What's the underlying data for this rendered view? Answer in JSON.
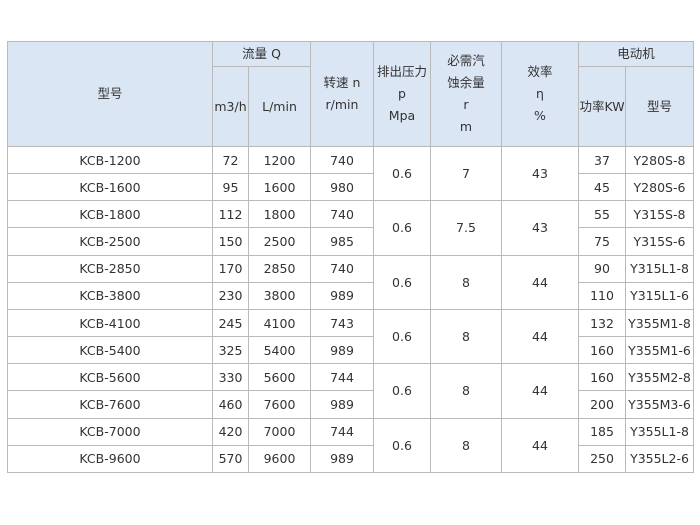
{
  "header": {
    "model": "型号",
    "flow": "流量 Q",
    "flow_m3h": "m3/h",
    "flow_lmin": "L/min",
    "speed_l1": "转速 n",
    "speed_l2": "r/min",
    "pressure_l1": "排出压力",
    "pressure_l2": "p",
    "pressure_l3": "Mpa",
    "npsh_l1": "必需汽",
    "npsh_l2": "蚀余量",
    "npsh_l3": "r",
    "npsh_l4": "m",
    "eff_l1": "效率",
    "eff_l2": "η",
    "eff_l3": "%",
    "motor": "电动机",
    "motor_power": "功率KW",
    "motor_model": "型号"
  },
  "groups": [
    {
      "pressure": "0.6",
      "npsh": "7",
      "efficiency": "43",
      "rows": [
        {
          "model": "KCB-1200",
          "m3h": "72",
          "lmin": "1200",
          "speed": "740",
          "power": "37",
          "motor": "Y280S-8"
        },
        {
          "model": "KCB-1600",
          "m3h": "95",
          "lmin": "1600",
          "speed": "980",
          "power": "45",
          "motor": "Y280S-6"
        }
      ]
    },
    {
      "pressure": "0.6",
      "npsh": "7.5",
      "efficiency": "43",
      "rows": [
        {
          "model": "KCB-1800",
          "m3h": "112",
          "lmin": "1800",
          "speed": "740",
          "power": "55",
          "motor": "Y315S-8"
        },
        {
          "model": "KCB-2500",
          "m3h": "150",
          "lmin": "2500",
          "speed": "985",
          "power": "75",
          "motor": "Y315S-6"
        }
      ]
    },
    {
      "pressure": "0.6",
      "npsh": "8",
      "efficiency": "44",
      "rows": [
        {
          "model": "KCB-2850",
          "m3h": "170",
          "lmin": "2850",
          "speed": "740",
          "power": "90",
          "motor": "Y315L1-8"
        },
        {
          "model": "KCB-3800",
          "m3h": "230",
          "lmin": "3800",
          "speed": "989",
          "power": "110",
          "motor": "Y315L1-6"
        }
      ]
    },
    {
      "pressure": "0.6",
      "npsh": "8",
      "efficiency": "44",
      "rows": [
        {
          "model": "KCB-4100",
          "m3h": "245",
          "lmin": "4100",
          "speed": "743",
          "power": "132",
          "motor": "Y355M1-8"
        },
        {
          "model": "KCB-5400",
          "m3h": "325",
          "lmin": "5400",
          "speed": "989",
          "power": "160",
          "motor": "Y355M1-6"
        }
      ]
    },
    {
      "pressure": "0.6",
      "npsh": "8",
      "efficiency": "44",
      "rows": [
        {
          "model": "KCB-5600",
          "m3h": "330",
          "lmin": "5600",
          "speed": "744",
          "power": "160",
          "motor": "Y355M2-8"
        },
        {
          "model": "KCB-7600",
          "m3h": "460",
          "lmin": "7600",
          "speed": "989",
          "power": "200",
          "motor": "Y355M3-6"
        }
      ]
    },
    {
      "pressure": "0.6",
      "npsh": "8",
      "efficiency": "44",
      "rows": [
        {
          "model": "KCB-7000",
          "m3h": "420",
          "lmin": "7000",
          "speed": "744",
          "power": "185",
          "motor": "Y355L1-8"
        },
        {
          "model": "KCB-9600",
          "m3h": "570",
          "lmin": "9600",
          "speed": "989",
          "power": "250",
          "motor": "Y355L2-6"
        }
      ]
    }
  ]
}
